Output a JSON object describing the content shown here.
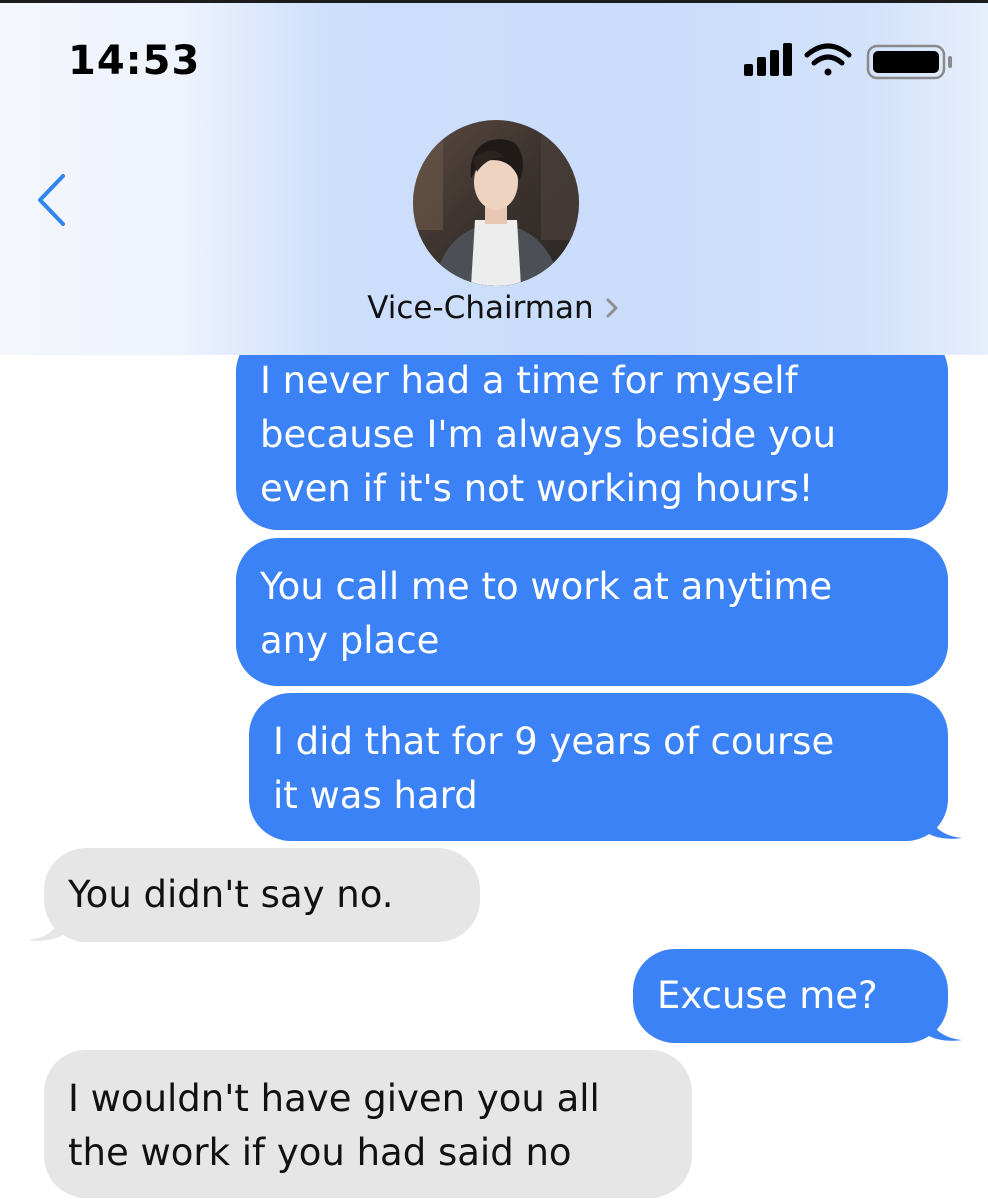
{
  "status_bar": {
    "time": "14:53",
    "icons": [
      "signal-icon",
      "wifi-icon",
      "battery-icon"
    ]
  },
  "header": {
    "back_icon": "chevron-left-icon",
    "contact_name": "Vice-Chairman",
    "contact_chevron_icon": "chevron-right-icon"
  },
  "colors": {
    "outgoing_bubble": "#3b82f6",
    "incoming_bubble": "#e6e6e6",
    "accent": "#2f86f0"
  },
  "messages": [
    {
      "direction": "outgoing",
      "lines": [
        "I never had a time for myself",
        "because I'm always beside you",
        "even if it's not working hours!"
      ]
    },
    {
      "direction": "outgoing",
      "lines": [
        "You call me to work at anytime",
        "any place"
      ]
    },
    {
      "direction": "outgoing",
      "lines": [
        "I did that for 9 years of course",
        "it was hard"
      ]
    },
    {
      "direction": "incoming",
      "lines": [
        "You didn't say no."
      ]
    },
    {
      "direction": "outgoing",
      "lines": [
        "Excuse me?"
      ]
    },
    {
      "direction": "incoming",
      "lines": [
        "I wouldn't have given you all",
        "the work if you had said no"
      ]
    }
  ]
}
